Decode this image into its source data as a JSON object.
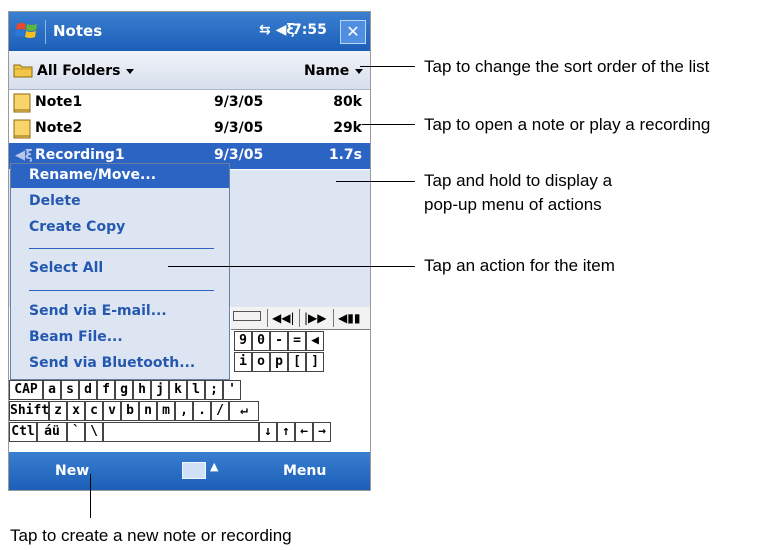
{
  "title_bar": {
    "app_title": "Notes",
    "tray_icons": "connectivity-and-speaker",
    "time": "7:55",
    "close": "✕"
  },
  "folder_bar": {
    "folder": "All Folders",
    "sort": "Name"
  },
  "list": [
    {
      "name": "Note1",
      "date": "9/3/05",
      "size": "80k",
      "icon": "note-icon"
    },
    {
      "name": "Note2",
      "date": "9/3/05",
      "size": "29k",
      "icon": "note-icon"
    },
    {
      "name": "Recording1",
      "date": "9/3/05",
      "size": "1.7s",
      "icon": "recording-icon",
      "selected": true
    }
  ],
  "popup_menu": {
    "items": [
      "Rename/Move...",
      "Delete",
      "Create Copy",
      "Select All",
      "Send via E-mail...",
      "Beam File...",
      "Send via Bluetooth..."
    ],
    "active_item": "Rename/Move..."
  },
  "keyboard": {
    "toolbar_glyphs": [
      "◀◀|",
      "|▶▶",
      "◀▮▮"
    ],
    "row1_visible": [
      "9",
      "0",
      "-",
      "=",
      "◀"
    ],
    "row2_visible": [
      "i",
      "o",
      "p",
      "[",
      "]"
    ],
    "row3": [
      "CAP",
      "a",
      "s",
      "d",
      "f",
      "g",
      "h",
      "j",
      "k",
      "l",
      ";",
      "'"
    ],
    "row4": [
      "Shift",
      "z",
      "x",
      "c",
      "v",
      "b",
      "n",
      "m",
      ",",
      ".",
      "/",
      "↵"
    ],
    "row5": [
      "Ctl",
      "áü",
      "`",
      "\\",
      "↓",
      "↑",
      "←",
      "→"
    ]
  },
  "bottom_bar": {
    "left": "New",
    "right": "Menu"
  },
  "callouts": {
    "sort": "Tap to change the sort order of the list",
    "open": "Tap to open a note or play a recording",
    "hold_line1": "Tap and hold to display a",
    "hold_line2": "pop-up menu of actions",
    "action": "Tap an action for the item",
    "new": "Tap to create a new note or recording"
  }
}
